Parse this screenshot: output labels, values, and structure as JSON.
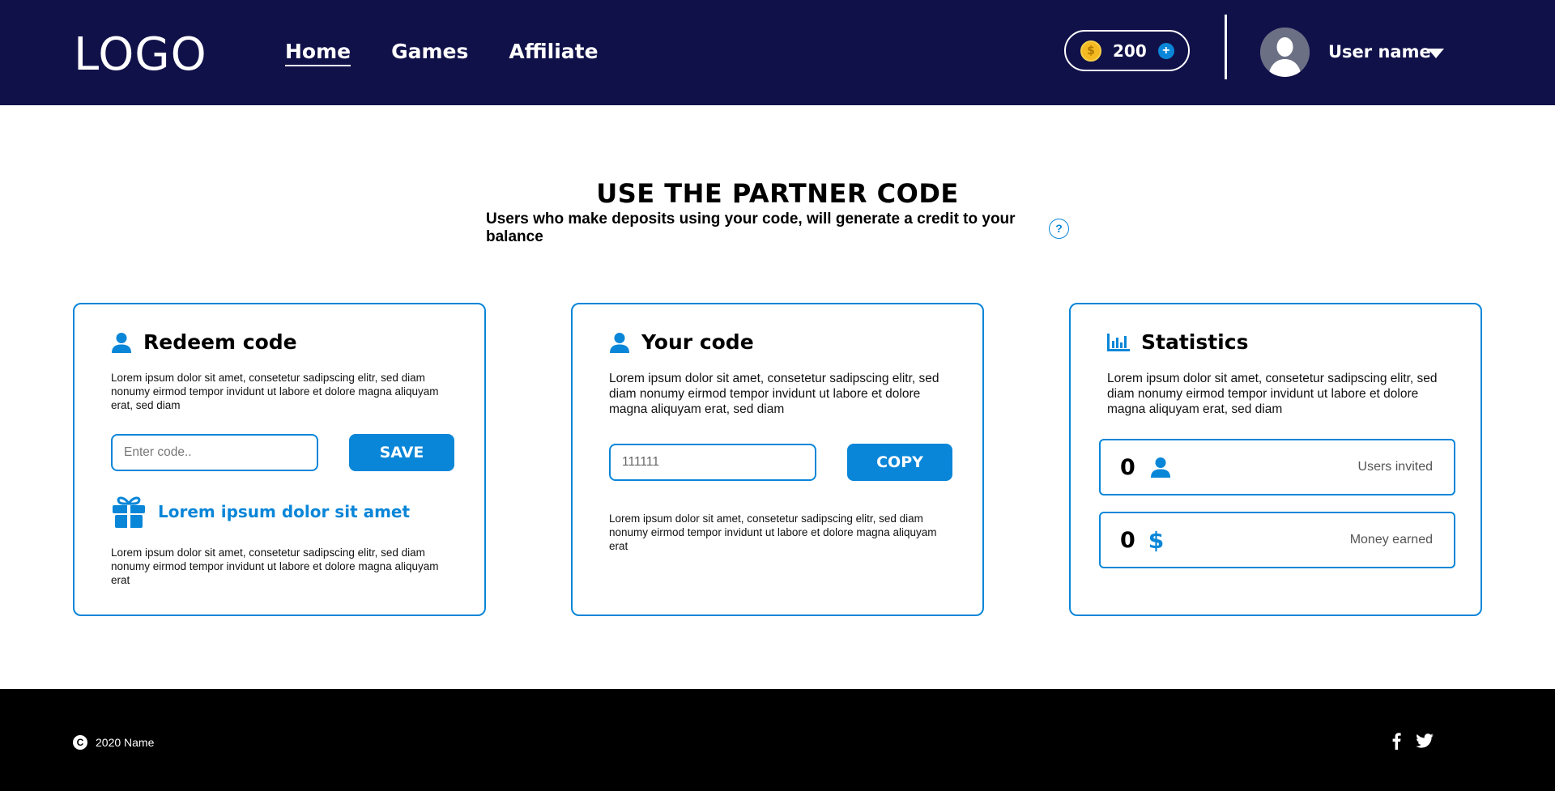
{
  "header": {
    "logo": "LOGO",
    "nav": [
      {
        "label": "Home",
        "active": true
      },
      {
        "label": "Games",
        "active": false
      },
      {
        "label": "Affiliate",
        "active": false
      }
    ],
    "balance": "200",
    "coin_symbol": "$",
    "user_name": "User name"
  },
  "hero": {
    "title": "USE THE PARTNER CODE",
    "subtitle": "Users who make deposits using your code, will generate a credit to your balance",
    "help_symbol": "?"
  },
  "redeem": {
    "title": "Redeem code",
    "description": "Lorem ipsum dolor sit amet, consetetur sadipscing elitr, sed diam nonumy eirmod tempor invidunt ut labore et dolore magna aliquyam erat, sed diam",
    "input_placeholder": "Enter code..",
    "save_label": "SAVE",
    "promo_title": "Lorem ipsum dolor sit amet",
    "promo_text": "Lorem ipsum dolor sit amet, consetetur sadipscing elitr, sed diam nonumy eirmod tempor invidunt ut labore et dolore magna aliquyam erat"
  },
  "your_code": {
    "title": "Your code",
    "description": "Lorem ipsum dolor sit amet, consetetur sadipscing elitr, sed diam nonumy eirmod tempor invidunt ut labore et dolore magna aliquyam erat, sed diam",
    "code_value": "111111",
    "copy_label": "COPY",
    "footnote": "Lorem ipsum dolor sit amet, consetetur sadipscing elitr, sed diam nonumy eirmod tempor invidunt ut labore et dolore magna aliquyam erat"
  },
  "statistics": {
    "title": "Statistics",
    "description": "Lorem ipsum dolor sit amet, consetetur sadipscing elitr, sed diam nonumy eirmod tempor invidunt ut labore et dolore magna aliquyam erat, sed diam",
    "users_invited_value": "0",
    "users_invited_label": "Users invited",
    "money_earned_value": "0",
    "money_earned_symbol": "$",
    "money_earned_label": "Money earned"
  },
  "footer": {
    "copyright_symbol": "C",
    "copyright_text": "2020 Name"
  },
  "icons": {
    "coin": "coin-icon",
    "plus": "plus-icon",
    "avatar": "user-avatar",
    "caret": "caret-down-icon",
    "help": "help-icon",
    "user": "user-icon",
    "gift": "gift-icon",
    "chart": "bar-chart-icon",
    "dollar": "dollar-icon",
    "copyright": "copyright-icon",
    "facebook": "facebook-icon",
    "twitter": "twitter-icon"
  },
  "colors": {
    "header_bg": "#11114a",
    "accent": "#0a86d8",
    "coin": "#f5b921",
    "footer_bg": "#000000"
  }
}
